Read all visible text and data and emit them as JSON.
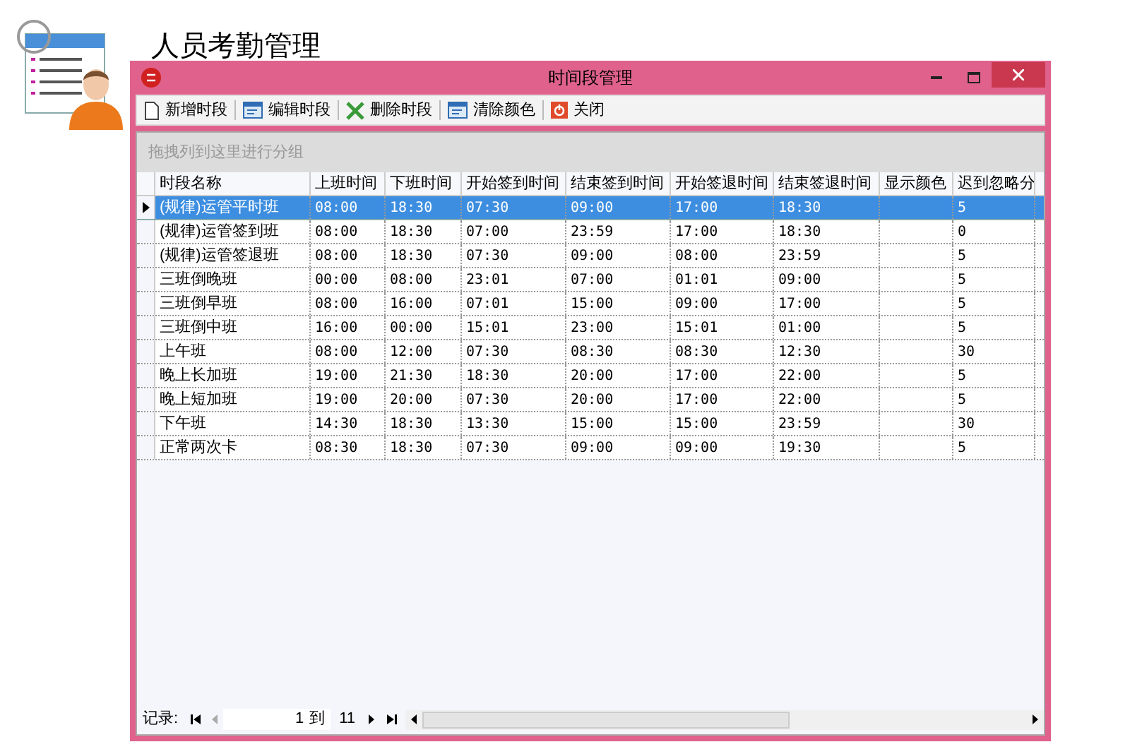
{
  "page_title": "人员考勤管理",
  "window": {
    "title": "时间段管理"
  },
  "toolbar": [
    {
      "kind": "new",
      "label": "新增时段"
    },
    {
      "kind": "edit",
      "label": "编辑时段"
    },
    {
      "kind": "delete",
      "label": "删除时段"
    },
    {
      "kind": "clear",
      "label": "清除颜色"
    },
    {
      "kind": "close",
      "label": "关闭"
    }
  ],
  "group_panel": {
    "placeholder": "拖拽列到这里进行分组"
  },
  "table": {
    "columns": [
      "时段名称",
      "上班时间",
      "下班时间",
      "开始签到时间",
      "结束签到时间",
      "开始签退时间",
      "结束签退时间",
      "显示颜色",
      "迟到忽略分"
    ],
    "rows": [
      {
        "selected": true,
        "cells": [
          "(规律)运管平时班",
          "08:00",
          "18:30",
          "07:30",
          "09:00",
          "17:00",
          "18:30",
          "",
          "5"
        ]
      },
      {
        "selected": false,
        "cells": [
          "(规律)运管签到班",
          "08:00",
          "18:30",
          "07:00",
          "23:59",
          "17:00",
          "18:30",
          "",
          "0"
        ]
      },
      {
        "selected": false,
        "cells": [
          "(规律)运管签退班",
          "08:00",
          "18:30",
          "07:30",
          "09:00",
          "08:00",
          "23:59",
          "",
          "5"
        ]
      },
      {
        "selected": false,
        "cells": [
          "三班倒晚班",
          "00:00",
          "08:00",
          "23:01",
          "07:00",
          "01:01",
          "09:00",
          "",
          "5"
        ]
      },
      {
        "selected": false,
        "cells": [
          "三班倒早班",
          "08:00",
          "16:00",
          "07:01",
          "15:00",
          "09:00",
          "17:00",
          "",
          "5"
        ]
      },
      {
        "selected": false,
        "cells": [
          "三班倒中班",
          "16:00",
          "00:00",
          "15:01",
          "23:00",
          "15:01",
          "01:00",
          "",
          "5"
        ]
      },
      {
        "selected": false,
        "cells": [
          "上午班",
          "08:00",
          "12:00",
          "07:30",
          "08:30",
          "08:30",
          "12:30",
          "",
          "30"
        ]
      },
      {
        "selected": false,
        "cells": [
          "晚上长加班",
          "19:00",
          "21:30",
          "18:30",
          "20:00",
          "17:00",
          "22:00",
          "",
          "5"
        ]
      },
      {
        "selected": false,
        "cells": [
          "晚上短加班",
          "19:00",
          "20:00",
          "07:30",
          "20:00",
          "17:00",
          "22:00",
          "",
          "5"
        ]
      },
      {
        "selected": false,
        "cells": [
          "下午班",
          "14:30",
          "18:30",
          "13:30",
          "15:00",
          "15:00",
          "23:59",
          "",
          "30"
        ]
      },
      {
        "selected": false,
        "cells": [
          "正常两次卡",
          "08:30",
          "18:30",
          "07:30",
          "09:00",
          "09:00",
          "19:30",
          "",
          "5"
        ]
      }
    ]
  },
  "pager": {
    "label": "记录:",
    "current": "1",
    "separator": "到",
    "total": "11"
  }
}
